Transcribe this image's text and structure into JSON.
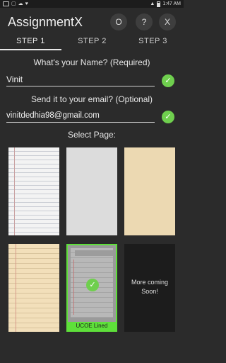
{
  "status_bar": {
    "left_icons": [
      "volte-icon",
      "chat-icon",
      "cloud-icon",
      "twitter-icon"
    ],
    "time": "1:47 AM"
  },
  "app": {
    "title": "AssignmentX",
    "buttons": [
      {
        "icon": "settings-icon",
        "glyph": "O"
      },
      {
        "icon": "help-icon",
        "glyph": "?"
      },
      {
        "icon": "close-icon",
        "glyph": "X"
      }
    ]
  },
  "tabs": [
    {
      "label": "STEP 1",
      "active": true
    },
    {
      "label": "STEP 2",
      "active": false
    },
    {
      "label": "STEP 3",
      "active": false
    }
  ],
  "form": {
    "name_label": "What's your Name? (Required)",
    "name_value": "Vinit",
    "email_label": "Send it to your email? (Optional)",
    "email_value": "vinitdedhia98@gmail.com",
    "check_glyph": "✓"
  },
  "pages": {
    "title": "Select Page:",
    "selected_caption": "UCOE Lined",
    "coming_soon": "More coming Soon!"
  },
  "colors": {
    "accent": "#5ee03a",
    "check": "#6fcf4e",
    "background": "#2b2b2b"
  }
}
